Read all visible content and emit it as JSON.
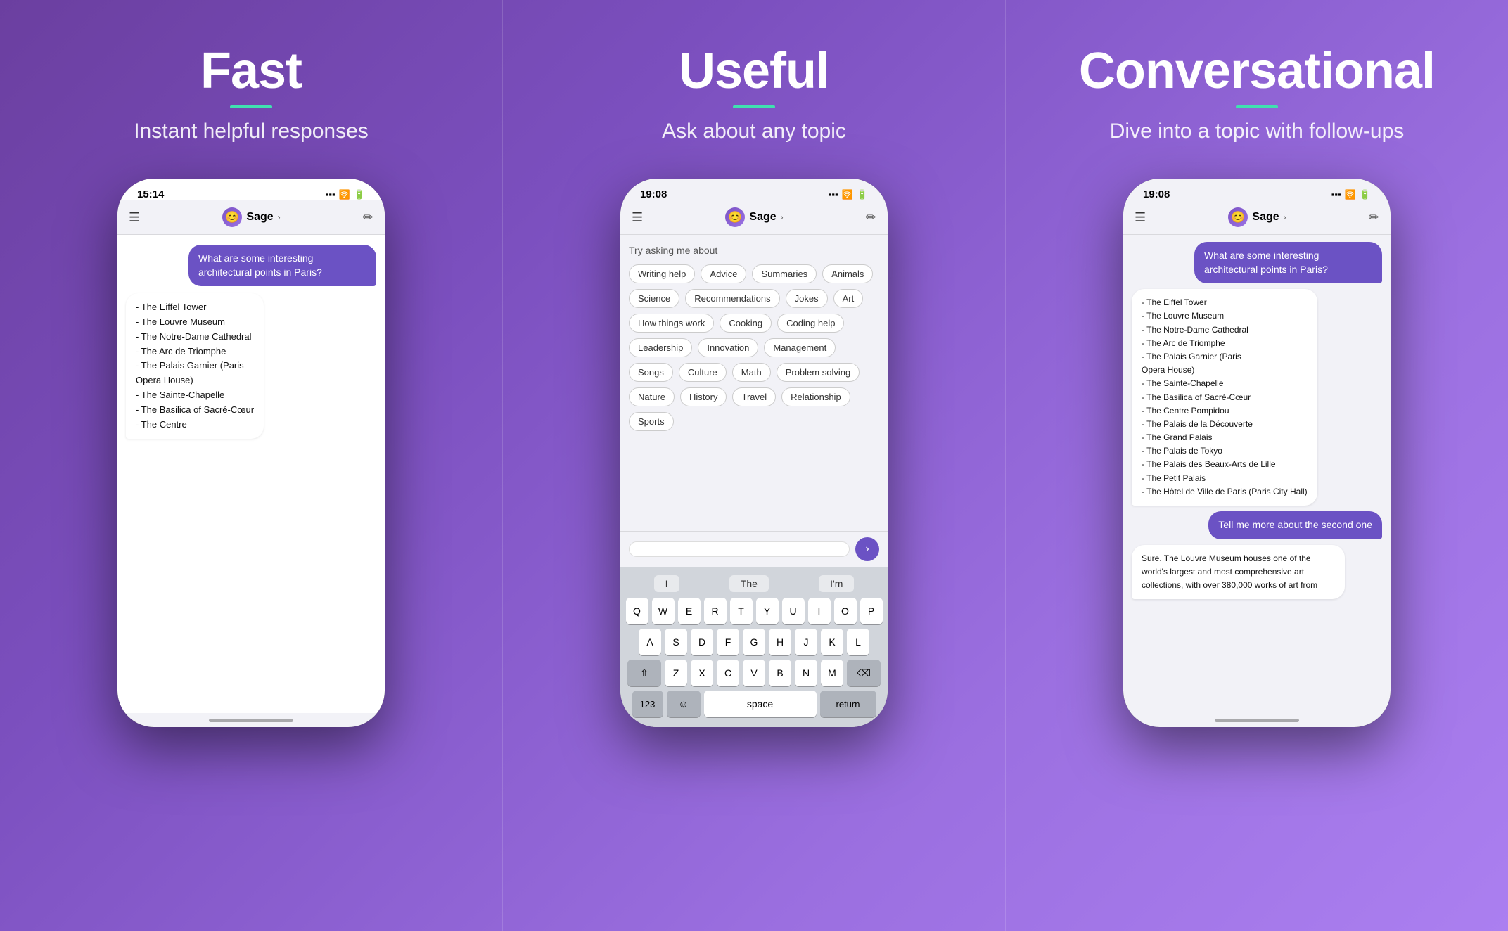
{
  "panels": [
    {
      "id": "fast",
      "title": "Fast",
      "subtitle": "Instant helpful responses",
      "phone_time": "15:14",
      "user_message": "What are some interesting architectural points in Paris?",
      "ai_response": "- The Eiffel Tower\n- The Louvre Museum\n- The Notre-Dame Cathedral\n- The Arc de Triomphe\n- The Palais Garnier (Paris Opera House)\n- The Sainte-Chapelle\n- The Basilica of Sacré-Cœur\n- The Centre"
    },
    {
      "id": "useful",
      "title": "Useful",
      "subtitle": "Ask about any topic",
      "phone_time": "19:08",
      "suggestions_label": "Try asking me about",
      "tags": [
        "Writing help",
        "Advice",
        "Summaries",
        "Animals",
        "Science",
        "Recommendations",
        "Jokes",
        "Art",
        "How things work",
        "Cooking",
        "Coding help",
        "Leadership",
        "Innovation",
        "Management",
        "Songs",
        "Culture",
        "Math",
        "Problem solving",
        "Nature",
        "History",
        "Travel",
        "Relationship",
        "Sports"
      ],
      "input_placeholder": "",
      "autocomplete": [
        "I",
        "The",
        "I'm"
      ],
      "keyboard_rows": [
        [
          "Q",
          "W",
          "E",
          "R",
          "T",
          "Y",
          "U",
          "I",
          "O",
          "P"
        ],
        [
          "A",
          "S",
          "D",
          "F",
          "G",
          "H",
          "J",
          "K",
          "L"
        ],
        [
          "⇧",
          "Z",
          "X",
          "C",
          "V",
          "B",
          "N",
          "M",
          "⌫"
        ],
        [
          "123",
          "☺",
          "space",
          "return"
        ]
      ]
    },
    {
      "id": "conversational",
      "title": "Conversational",
      "subtitle": "Dive into a topic with follow-ups",
      "phone_time": "19:08",
      "user_message": "What are some interesting architectural points in Paris?",
      "ai_response1": "- The Eiffel Tower\n- The Louvre Museum\n- The Notre-Dame Cathedral\n- The Arc de Triomphe\n- The Palais Garnier (Paris Opera House)\n- The Sainte-Chapelle\n- The Basilica of Sacré-Cœur\n- The Centre Pompidou\n- The Palais de la Découverte\n- The Grand Palais\n- The Palais de Tokyo\n- The Palais des Beaux-Arts de Lille\n- The Petit Palais\n- The Hôtel de Ville de Paris (Paris City Hall)",
      "user_message2": "Tell me more about the second one",
      "ai_response2": "Sure. The Louvre Museum houses one of the world's largest and most comprehensive art collections, with over 380,000 works of art from"
    }
  ],
  "brand_color": "#6b52c4",
  "accent_color": "#40e0b0",
  "nav_name": "Sage",
  "nav_avatar_emoji": "🤖"
}
